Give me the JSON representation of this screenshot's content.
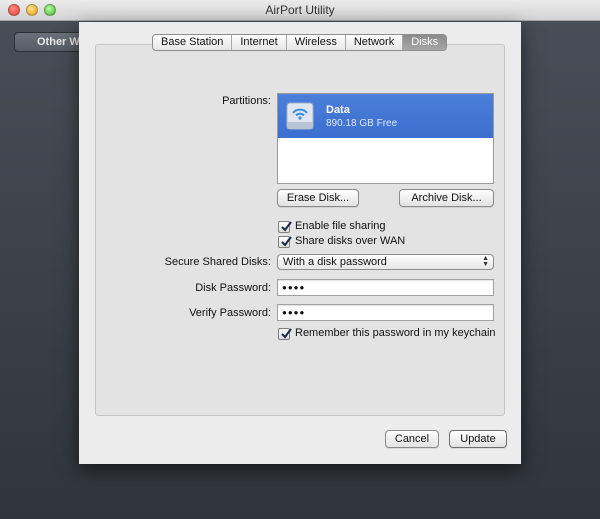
{
  "window": {
    "title": "AirPort Utility",
    "background_button_label": "Other W"
  },
  "tabs": [
    {
      "label": "Base Station",
      "active": false
    },
    {
      "label": "Internet",
      "active": false
    },
    {
      "label": "Wireless",
      "active": false
    },
    {
      "label": "Network",
      "active": false
    },
    {
      "label": "Disks",
      "active": true
    }
  ],
  "disks": {
    "partitions_label": "Partitions:",
    "partition": {
      "name": "Data",
      "size": "890.18 GB Free",
      "icon": "wifi-disk-icon"
    },
    "erase_button": "Erase Disk...",
    "archive_button": "Archive Disk...",
    "enable_file_sharing": {
      "label": "Enable file sharing",
      "checked": true
    },
    "share_over_wan": {
      "label": "Share disks over WAN",
      "checked": true
    },
    "secure_label": "Secure Shared Disks:",
    "secure_value": "With a disk password",
    "disk_password_label": "Disk Password:",
    "disk_password_value": "●●●●",
    "verify_password_label": "Verify Password:",
    "verify_password_value": "●●●●",
    "remember_keychain": {
      "label": "Remember this password in my keychain",
      "checked": true
    }
  },
  "footer": {
    "cancel": "Cancel",
    "update": "Update"
  },
  "colors": {
    "selection": "#3d6fd0",
    "active_tab": "#9a9a9a"
  }
}
